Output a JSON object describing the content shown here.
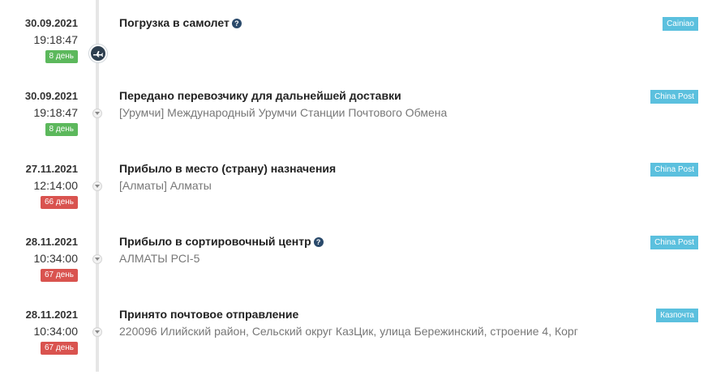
{
  "events": [
    {
      "date": "30.09.2021",
      "time": "19:18:47",
      "days": "8 день",
      "days_color": "#5cb85c",
      "title": "Погрузка в самолет",
      "has_help": true,
      "location": "",
      "carrier": "Cainiao",
      "icon": "airplane-icon"
    },
    {
      "date": "30.09.2021",
      "time": "19:18:47",
      "days": "8 день",
      "days_color": "#5cb85c",
      "title": "Передано перевозчику для дальнейшей доставки",
      "has_help": false,
      "location": "[Урумчи] Международный Урумчи Станции Почтового Обмена",
      "carrier": "China Post",
      "icon": "chevron-down-icon"
    },
    {
      "date": "27.11.2021",
      "time": "12:14:00",
      "days": "66 день",
      "days_color": "#d9534f",
      "title": "Прибыло в место (страну) назначения",
      "has_help": false,
      "location": "[Алматы] Алматы",
      "carrier": "China Post",
      "icon": "chevron-down-icon"
    },
    {
      "date": "28.11.2021",
      "time": "10:34:00",
      "days": "67 день",
      "days_color": "#d9534f",
      "title": "Прибыло в сортировочный центр",
      "has_help": true,
      "location": "АЛМАТЫ PCI-5",
      "carrier": "China Post",
      "icon": "chevron-down-icon"
    },
    {
      "date": "28.11.2021",
      "time": "10:34:00",
      "days": "67 день",
      "days_color": "#d9534f",
      "title": "Принято почтовое отправление",
      "has_help": false,
      "location": "220096 Илийский район, Сельский округ КазЦик, улица Бережинский, строение 4, Корг",
      "carrier": "Казпочта",
      "icon": "chevron-down-icon"
    }
  ],
  "help_glyph": "?"
}
